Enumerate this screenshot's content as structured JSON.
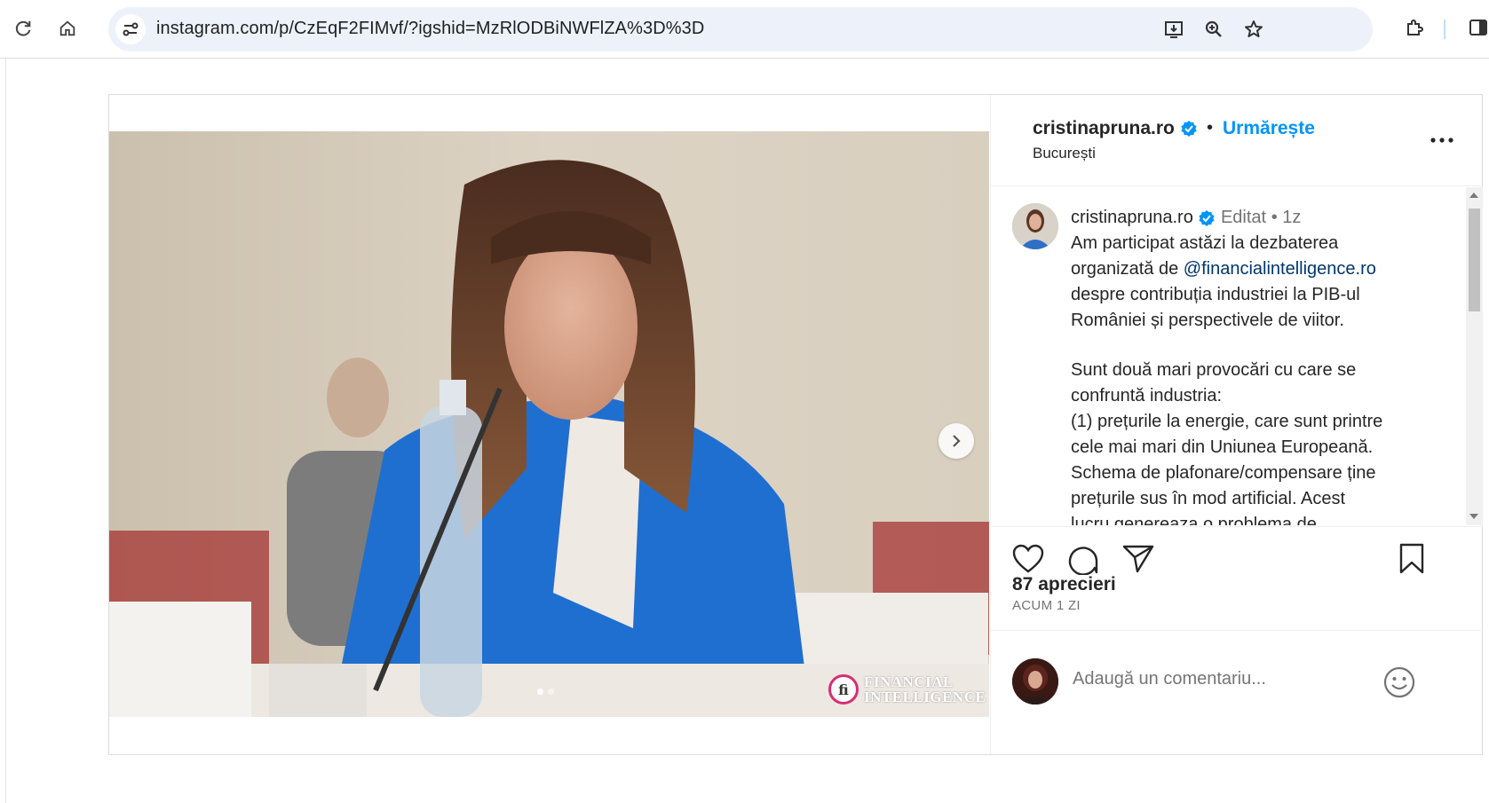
{
  "browser": {
    "url": "instagram.com/p/CzEqF2FIMvf/?igshid=MzRlODBiNWFlZA%3D%3D",
    "icons": [
      "reload-icon",
      "home-icon",
      "site-info-icon",
      "install-icon",
      "zoom-icon",
      "bookmark-star-icon",
      "extensions-icon",
      "side-panel-icon"
    ]
  },
  "post": {
    "image": {
      "watermark_line1": "FINANCIAL",
      "watermark_line2": "INTELLIGENCE",
      "watermark_logo": "fi",
      "carousel_dots": 2,
      "carousel_active": 1
    },
    "header": {
      "username": "cristinapruna.ro",
      "separator": "•",
      "follow_label": "Urmărește",
      "location": "București"
    },
    "caption": {
      "username": "cristinapruna.ro",
      "edited": "Editat",
      "separator": "•",
      "time": "1z",
      "line1": "Am participat astăzi la dezbaterea",
      "line2_prefix": "organizată de ",
      "mention": "@financialintelligence.ro",
      "line3": "despre contribuția industriei la PIB-ul",
      "line4": "României și perspectivele de viitor.",
      "line5": "Sunt două mari provocări cu care se",
      "line6": "confruntă industria:",
      "line7": "(1) prețurile la energie, care sunt printre",
      "line8": "cele mai mari din Uniunea Europeană.",
      "line9": "Schema de plafonare/compensare țin",
      "line9b": "e",
      "line10": "prețurile sus în mod artificial. Acest",
      "line11": "lucru genereaza o problema de"
    },
    "stats": {
      "likes": "87 aprecieri",
      "ago": "ACUM 1 ZI"
    },
    "comment": {
      "placeholder": "Adaugă un comentariu..."
    }
  },
  "colors": {
    "accent": "#0095f6",
    "mention": "#00376b",
    "verified": "#0095f6"
  }
}
